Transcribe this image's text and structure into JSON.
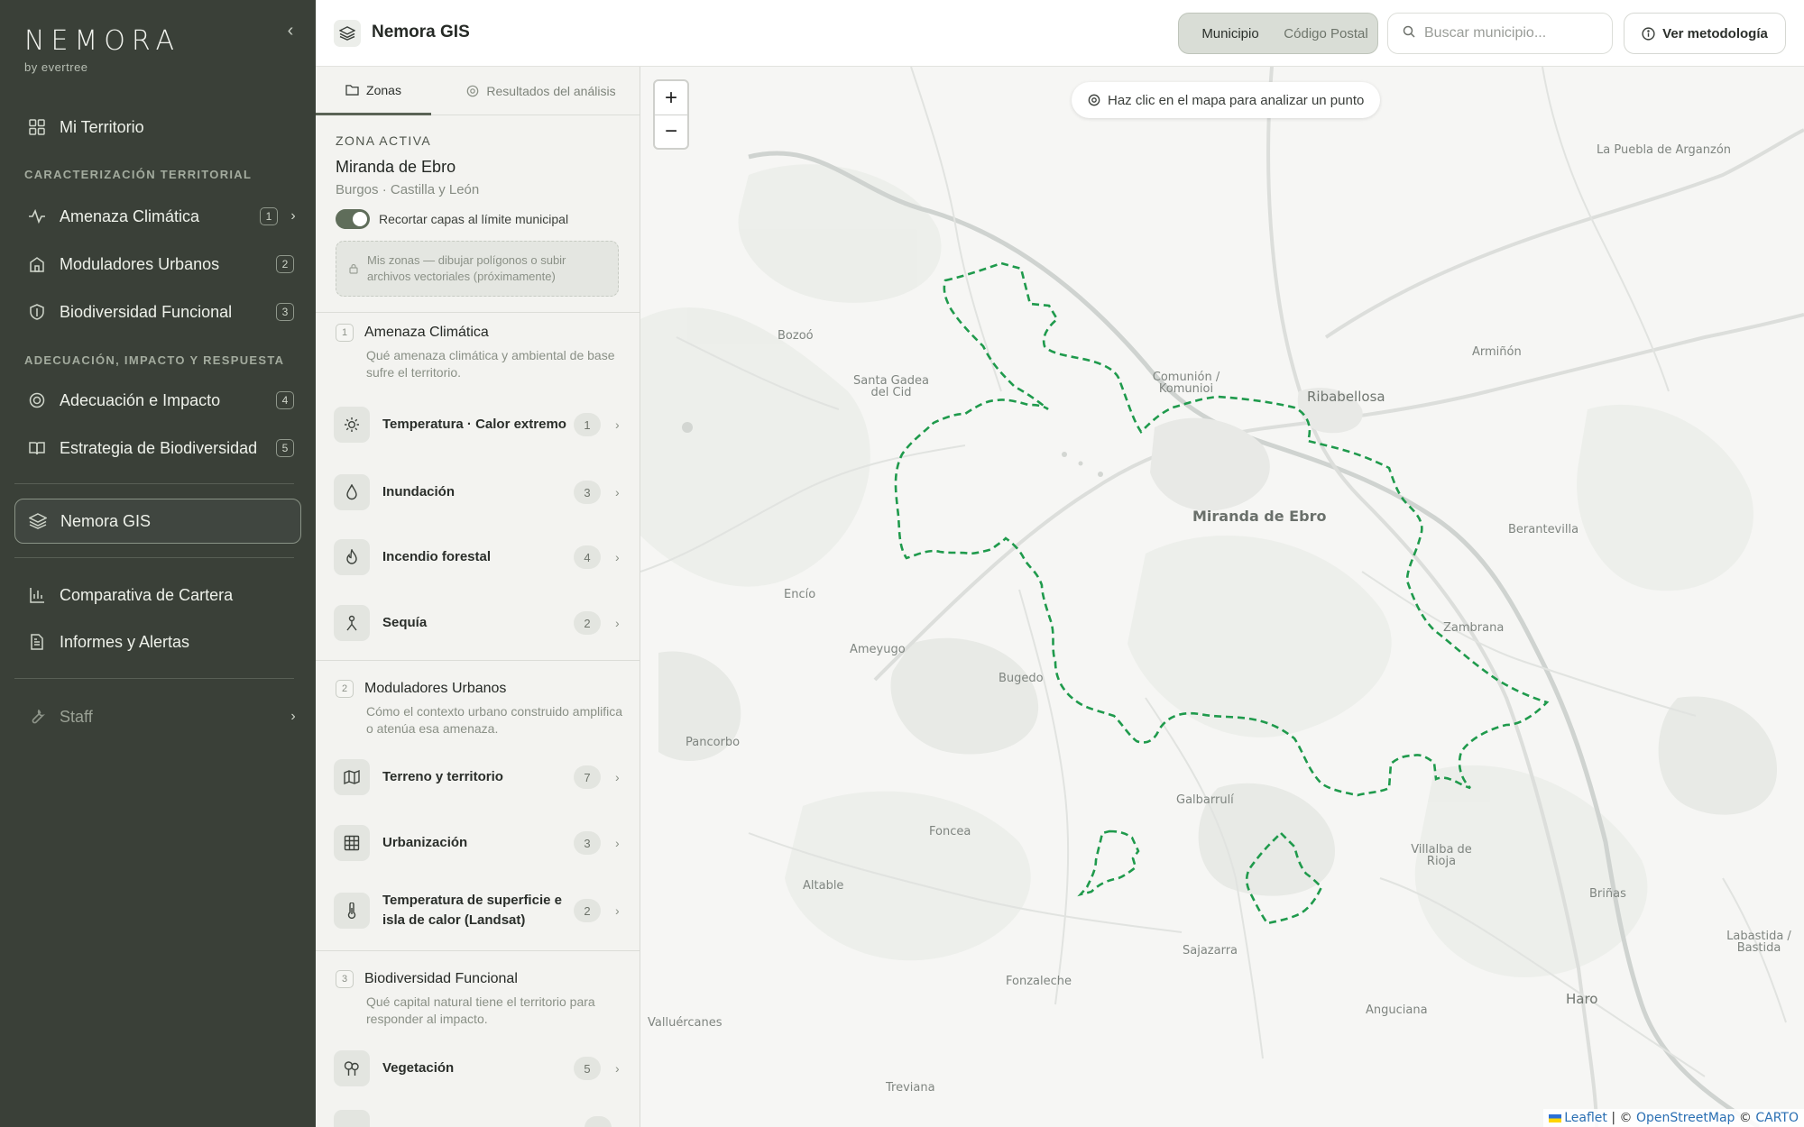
{
  "brand": {
    "name": "NEMORA",
    "sub": "by evertree"
  },
  "sidebar": {
    "home": "Mi Territorio",
    "section1": "CARACTERIZACIÓN TERRITORIAL",
    "items1": [
      {
        "label": "Amenaza Climática",
        "badge": "1"
      },
      {
        "label": "Moduladores Urbanos",
        "badge": "2"
      },
      {
        "label": "Biodiversidad Funcional",
        "badge": "3"
      }
    ],
    "section2": "ADECUACIÓN, IMPACTO Y RESPUESTA",
    "items2": [
      {
        "label": "Adecuación e Impacto",
        "badge": "4"
      },
      {
        "label": "Estrategia de Biodiversidad",
        "badge": "5"
      }
    ],
    "gis": "Nemora GIS",
    "compare": "Comparativa de Cartera",
    "reports": "Informes y Alertas",
    "staff": "Staff"
  },
  "topbar": {
    "title": "Nemora GIS",
    "seg_municipio": "Municipio",
    "seg_cp": "Código Postal",
    "search_placeholder": "Buscar municipio...",
    "method": "Ver metodología"
  },
  "panel": {
    "tab_zonas": "Zonas",
    "tab_resultados": "Resultados del análisis",
    "zone_label": "ZONA ACTIVA",
    "zone_name": "Miranda de Ebro",
    "zone_sub": "Burgos · Castilla y León",
    "toggle_label": "Recortar capas al límite municipal",
    "zones_box": "Mis zonas — dibujar polígonos o subir archivos vectoriales (próximamente)",
    "groups": [
      {
        "num": "1",
        "title": "Amenaza Climática",
        "desc": "Qué amenaza climática y ambiental de base sufre el territorio."
      },
      {
        "num": "2",
        "title": "Moduladores Urbanos",
        "desc": "Cómo el contexto urbano construido amplifica o atenúa esa amenaza."
      },
      {
        "num": "3",
        "title": "Biodiversidad Funcional",
        "desc": "Qué capital natural tiene el territorio para responder al impacto."
      }
    ],
    "items": [
      {
        "label": "Temperatura · Calor extremo",
        "count": "1",
        "icon": "sun-icon"
      },
      {
        "label": "Inundación",
        "count": "3",
        "icon": "drop-icon"
      },
      {
        "label": "Incendio forestal",
        "count": "4",
        "icon": "flame-icon"
      },
      {
        "label": "Sequía",
        "count": "2",
        "icon": "sprout-icon"
      },
      {
        "label": "Terreno y territorio",
        "count": "7",
        "icon": "map-icon"
      },
      {
        "label": "Urbanización",
        "count": "3",
        "icon": "grid-icon"
      },
      {
        "label": "Temperatura de superficie e isla de calor (Landsat)",
        "count": "2",
        "icon": "thermometer-icon"
      },
      {
        "label": "Vegetación",
        "count": "5",
        "icon": "trees-icon"
      }
    ]
  },
  "map": {
    "hint": "Haz clic en el mapa para analizar un punto",
    "zoom_in": "+",
    "zoom_out": "−",
    "attrib_leaflet": "Leaflet",
    "attrib_sep1": " | © ",
    "attrib_osm": "OpenStreetMap",
    "attrib_sep2": " © ",
    "attrib_carto": "CARTO",
    "boundary_color": "#1f9a4c",
    "places": [
      "La Puebla de Arganzón",
      "Bozoó",
      "Santa Gadea del Cid",
      "Comunión / Komunioi",
      "Ribabellosa",
      "Armiñón",
      "Miranda de Ebro",
      "Berantevilla",
      "Encío",
      "Zambrana",
      "Ameyugo",
      "Bugedo",
      "Pancorbo",
      "Galbarrulí",
      "Foncea",
      "Villalba de Rioja",
      "Altable",
      "Briñas",
      "Labastida / Bastida",
      "Sajazarra",
      "Fonzaleche",
      "Anguciana",
      "Haro",
      "Valluércanes",
      "Treviana"
    ]
  }
}
